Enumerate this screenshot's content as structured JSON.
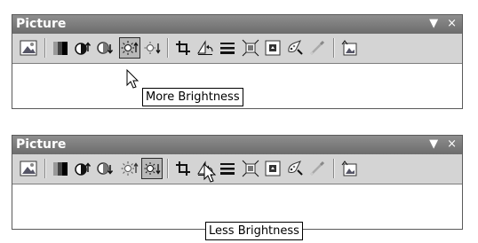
{
  "panels": [
    {
      "title": "Picture",
      "tooltip": "More Brightness",
      "hot_button": "more-brightness",
      "controls": {
        "dropdown": "▼",
        "close": "×"
      }
    },
    {
      "title": "Picture",
      "tooltip": "Less Brightness",
      "hot_button": "less-brightness",
      "controls": {
        "dropdown": "▼",
        "close": "×"
      }
    }
  ],
  "toolbar_buttons": [
    {
      "id": "insert-picture",
      "icon": "insert-picture-icon"
    },
    {
      "id": "color",
      "icon": "color-icon"
    },
    {
      "id": "more-contrast",
      "icon": "more-contrast-icon"
    },
    {
      "id": "less-contrast",
      "icon": "less-contrast-icon"
    },
    {
      "id": "more-brightness",
      "icon": "more-brightness-icon"
    },
    {
      "id": "less-brightness",
      "icon": "less-brightness-icon"
    },
    {
      "id": "crop",
      "icon": "crop-icon"
    },
    {
      "id": "rotate-left",
      "icon": "rotate-left-icon"
    },
    {
      "id": "line-style",
      "icon": "line-style-icon"
    },
    {
      "id": "compress-pictures",
      "icon": "compress-pictures-icon"
    },
    {
      "id": "text-wrapping",
      "icon": "text-wrapping-icon"
    },
    {
      "id": "format-picture",
      "icon": "format-picture-icon"
    },
    {
      "id": "set-transparent-color",
      "icon": "set-transparent-color-icon"
    },
    {
      "id": "reset-picture",
      "icon": "reset-picture-icon"
    }
  ],
  "colors": {
    "titlebar": "#7a7a7a",
    "toolbar": "#d4d4d4",
    "hot": "#b8b8b8"
  }
}
